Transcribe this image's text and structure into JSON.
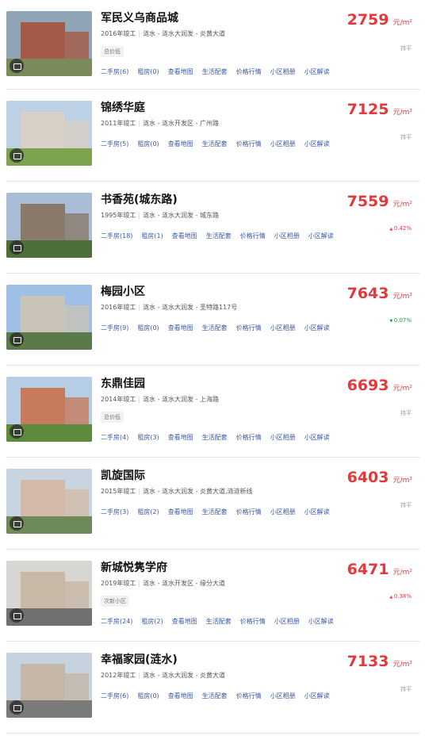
{
  "unit": "元/m²",
  "items": [
    {
      "name": "军民义乌商品城",
      "year": "2016年竣工",
      "area": "涟水 - 涟水大润发 - 炎黄大道",
      "tag": "总价低",
      "links": [
        "二手房(6)",
        "租房(0)",
        "查看地图",
        "生活配套",
        "价格行情",
        "小区相册",
        "小区解读"
      ],
      "price": "2759",
      "change": "持平",
      "trend": "flat"
    },
    {
      "name": "锦绣华庭",
      "year": "2011年竣工",
      "area": "涟水 - 涟水开发区 - 广州路",
      "tag": "",
      "links": [
        "二手房(5)",
        "租房(0)",
        "查看地图",
        "生活配套",
        "价格行情",
        "小区相册",
        "小区解读"
      ],
      "price": "7125",
      "change": "持平",
      "trend": "flat"
    },
    {
      "name": "书香苑(城东路)",
      "year": "1995年竣工",
      "area": "涟水 - 涟水大润发 - 城东路",
      "tag": "",
      "links": [
        "二手房(18)",
        "租房(1)",
        "查看地图",
        "生活配套",
        "价格行情",
        "小区相册",
        "小区解读"
      ],
      "price": "7559",
      "change": "0.42%",
      "trend": "up"
    },
    {
      "name": "梅园小区",
      "year": "2016年竣工",
      "area": "涟水 - 涟水大润发 - 圣特路117号",
      "tag": "",
      "links": [
        "二手房(9)",
        "租房(0)",
        "查看地图",
        "生活配套",
        "价格行情",
        "小区相册",
        "小区解读"
      ],
      "price": "7643",
      "change": "0.07%",
      "trend": "down"
    },
    {
      "name": "东鼎佳园",
      "year": "2014年竣工",
      "area": "涟水 - 涟水大润发 - 上海路",
      "tag": "总价低",
      "links": [
        "二手房(4)",
        "租房(3)",
        "查看地图",
        "生活配套",
        "价格行情",
        "小区相册",
        "小区解读"
      ],
      "price": "6693",
      "change": "持平",
      "trend": "flat"
    },
    {
      "name": "凯旋国际",
      "year": "2015年竣工",
      "area": "涟水 - 涟水大润发 - 炎黄大道,涟涟新线",
      "tag": "",
      "links": [
        "二手房(3)",
        "租房(2)",
        "查看地图",
        "生活配套",
        "价格行情",
        "小区相册",
        "小区解读"
      ],
      "price": "6403",
      "change": "持平",
      "trend": "flat"
    },
    {
      "name": "新城悦隽学府",
      "year": "2019年竣工",
      "area": "涟水 - 涟水开发区 - 缘分大道",
      "tag": "次新小区",
      "links": [
        "二手房(24)",
        "租房(2)",
        "查看地图",
        "生活配套",
        "价格行情",
        "小区相册",
        "小区解读"
      ],
      "price": "6471",
      "change": "0.38%",
      "trend": "up"
    },
    {
      "name": "幸福家园(涟水)",
      "year": "2012年竣工",
      "area": "涟水 - 涟水大润发 - 炎黄大道",
      "tag": "",
      "links": [
        "二手房(6)",
        "租房(0)",
        "查看地图",
        "生活配套",
        "价格行情",
        "小区相册",
        "小区解读"
      ],
      "price": "7133",
      "change": "持平",
      "trend": "flat"
    }
  ],
  "colors": {
    "price": "#e4393c",
    "link": "#3b5aa8",
    "up": "#e4393c",
    "down": "#2a9a48"
  }
}
